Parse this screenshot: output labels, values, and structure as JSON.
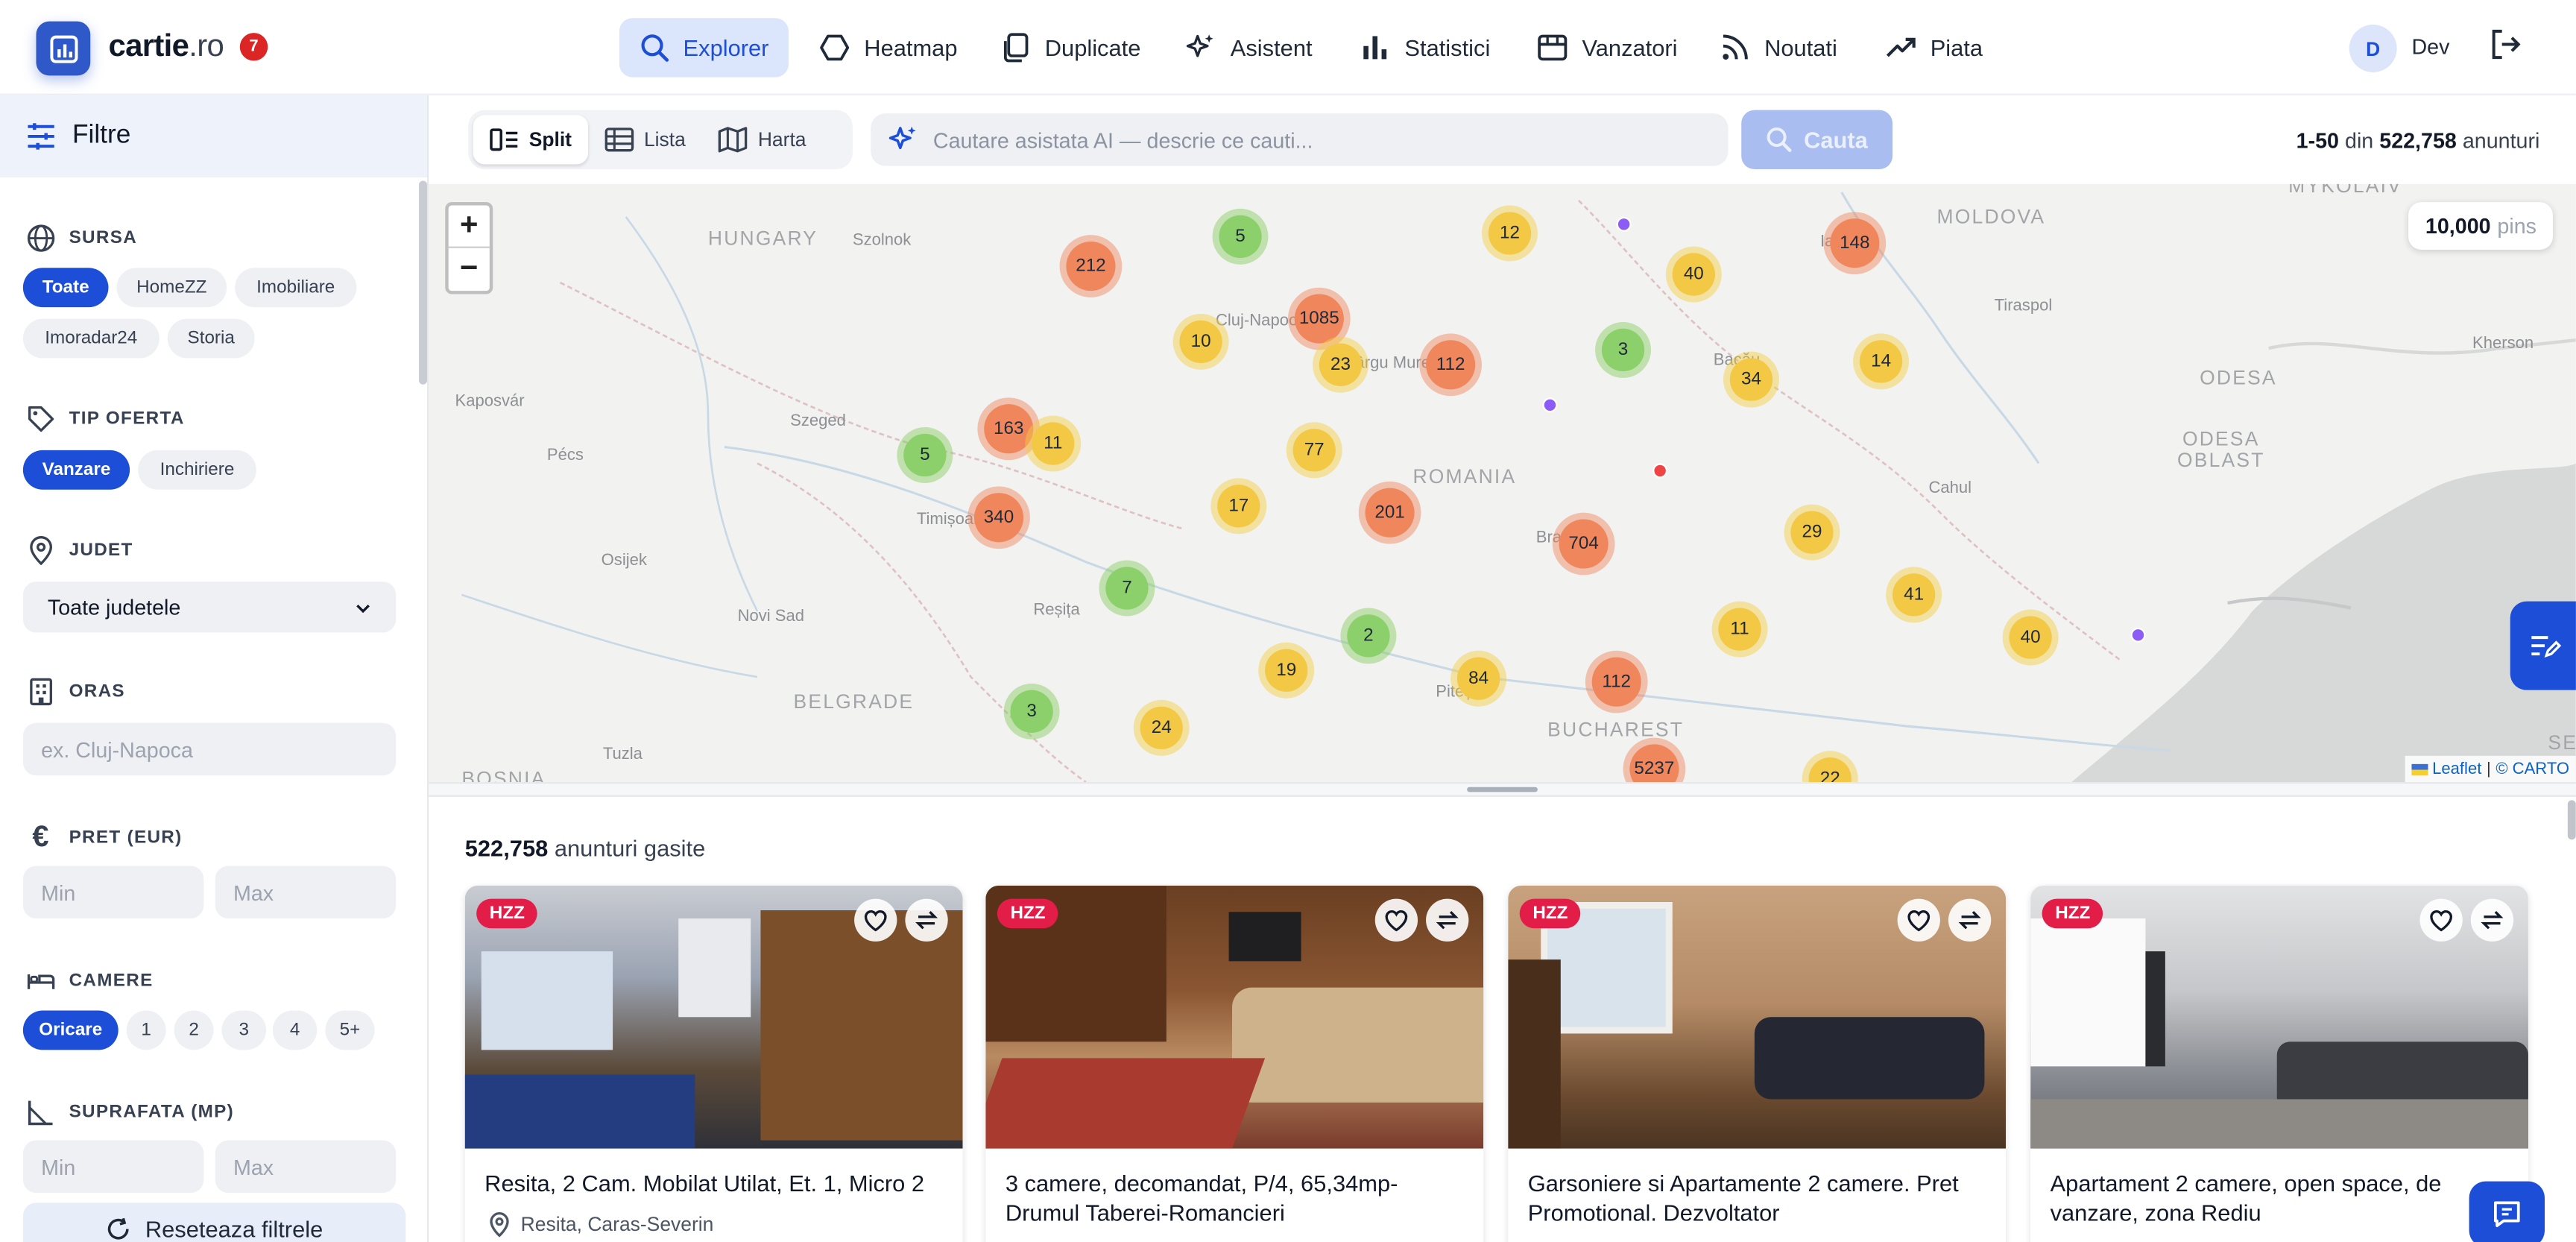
{
  "brand": {
    "name": "cartie",
    "tld": ".ro",
    "notifications": "7"
  },
  "nav": {
    "items": [
      {
        "label": "Explorer",
        "icon": "search-icon"
      },
      {
        "label": "Heatmap",
        "icon": "hexagon-icon"
      },
      {
        "label": "Duplicate",
        "icon": "copy-icon"
      },
      {
        "label": "Asistent",
        "icon": "sparkles-icon"
      },
      {
        "label": "Statistici",
        "icon": "bar-chart-icon"
      },
      {
        "label": "Vanzatori",
        "icon": "store-icon"
      },
      {
        "label": "Noutati",
        "icon": "rss-icon"
      },
      {
        "label": "Piata",
        "icon": "trending-up-icon"
      }
    ],
    "active": "Explorer"
  },
  "user": {
    "initial": "D",
    "name": "Dev"
  },
  "sidebar": {
    "title": "Filtre",
    "sursa": {
      "label": "SURSA",
      "options": [
        "Toate",
        "HomeZZ",
        "Imobiliare",
        "Imoradar24",
        "Storia"
      ],
      "selected": "Toate"
    },
    "tip_oferta": {
      "label": "TIP OFERTA",
      "options": [
        "Vanzare",
        "Inchiriere"
      ],
      "selected": "Vanzare"
    },
    "judet": {
      "label": "JUDET",
      "value": "Toate judetele"
    },
    "oras": {
      "label": "ORAS",
      "placeholder": "ex. Cluj-Napoca"
    },
    "pret": {
      "label": "PRET (EUR)",
      "min_placeholder": "Min",
      "max_placeholder": "Max"
    },
    "camere": {
      "label": "CAMERE",
      "options": [
        "Oricare",
        "1",
        "2",
        "3",
        "4",
        "5+"
      ],
      "selected": "Oricare"
    },
    "suprafata": {
      "label": "SUPRAFATA (MP)",
      "min_placeholder": "Min",
      "max_placeholder": "Max"
    },
    "reset_label": "Reseteaza filtrele"
  },
  "toolbar": {
    "views": [
      "Split",
      "Lista",
      "Harta"
    ],
    "active_view": "Split",
    "search_placeholder": "Cautare asistata AI — descrie ce cauti...",
    "search_button": "Cauta",
    "range": "1-50",
    "range_of": "din",
    "total": "522,758",
    "total_suffix": "anunturi"
  },
  "map": {
    "pins_count": "10,000",
    "pins_label": "pins",
    "attribution": {
      "leaflet": "Leaflet",
      "separator": "|",
      "carto": "© CARTO"
    },
    "labels": [
      "HUNGARY",
      "Szolnok",
      "Kaposvár",
      "Pécs",
      "Szeged",
      "Osijek",
      "Novi Sad",
      "BELGRADE",
      "Tuzla",
      "BOSNIA",
      "Timișoara",
      "Reșița",
      "Cluj-Napoca",
      "Târgu Mureș",
      "ROMANIA",
      "Brașov",
      "Pitești",
      "BUCHAREST",
      "Bacău",
      "Iași",
      "MOLDOVA",
      "Tiraspol",
      "Cahul",
      "MYKOLAIV",
      "Kherson",
      "ODESA",
      "ODESA OBLAST",
      "SEV"
    ],
    "clusters": [
      "212",
      "5",
      "12",
      "148",
      "40",
      "1085",
      "10",
      "23",
      "112",
      "3",
      "34",
      "14",
      "163",
      "11",
      "5",
      "77",
      "340",
      "17",
      "201",
      "704",
      "29",
      "7",
      "41",
      "2",
      "11",
      "40",
      "19",
      "84",
      "112",
      "3",
      "24",
      "5237",
      "22"
    ]
  },
  "results": {
    "count": "522,758",
    "count_suffix": "anunturi gasite",
    "cards": [
      {
        "badge": "HZZ",
        "title": "Resita, 2 Cam. Mobilat Utilat, Et. 1, Micro 2",
        "location": "Resita, Caras-Severin"
      },
      {
        "badge": "HZZ",
        "title": "3 camere, decomandat, P/4, 65,34mp-Drumul Taberei-Romancieri",
        "location": ""
      },
      {
        "badge": "HZZ",
        "title": "Garsoniere si Apartamente 2 camere. Pret Promotional. Dezvoltator",
        "location": ""
      },
      {
        "badge": "HZZ",
        "title": "Apartament 2 camere, open space, de vanzare, zona Rediu",
        "location": ""
      }
    ]
  },
  "colors": {
    "primary": "#1d4ed8",
    "badge": "#e11d48",
    "cluster_green": "#8bd06a",
    "cluster_yellow": "#f3c845",
    "cluster_orange": "#f0875c"
  }
}
